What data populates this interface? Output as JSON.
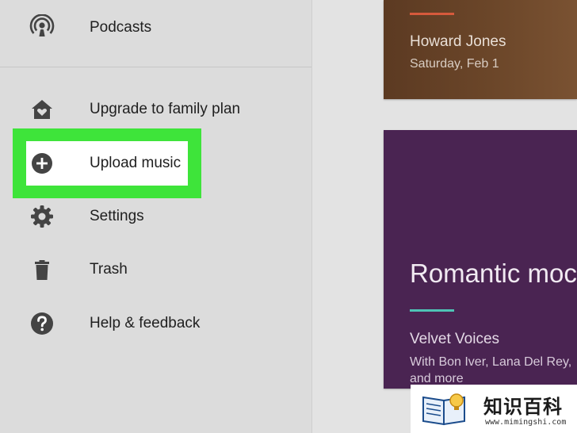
{
  "sidebar": {
    "items": [
      {
        "label": "Podcasts",
        "icon": "podcast-icon"
      },
      {
        "label": "Upgrade to family plan",
        "icon": "family-home-icon"
      },
      {
        "label": "Upload music",
        "icon": "add-circle-icon"
      },
      {
        "label": "Settings",
        "icon": "gear-icon"
      },
      {
        "label": "Trash",
        "icon": "trash-icon"
      },
      {
        "label": "Help & feedback",
        "icon": "help-icon"
      }
    ]
  },
  "cards": {
    "top": {
      "title": "Howard Jones",
      "subtitle": "Saturday, Feb 1"
    },
    "main": {
      "heading": "Romantic moc",
      "playlist": "Velvet Voices",
      "desc_line1": "With Bon Iver, Lana Del Rey,",
      "desc_line2": "and more"
    }
  },
  "watermark": {
    "text": "知识百科",
    "url": "www.mimingshi.com"
  },
  "colors": {
    "highlight": "#3ee43a",
    "card_top_bg": "#6b4629",
    "card_main_bg": "#4a2452",
    "accent_orange": "#d65a3c",
    "accent_teal": "#4fc3b6"
  }
}
